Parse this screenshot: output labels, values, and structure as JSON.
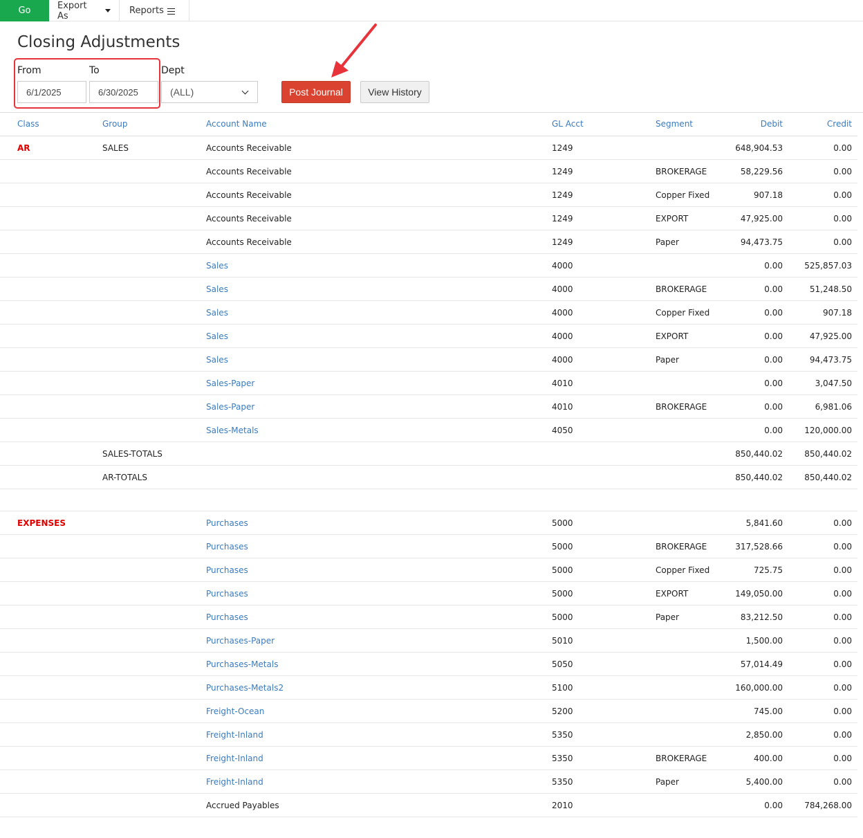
{
  "toolbar": {
    "go_label": "Go",
    "export_label": "Export As",
    "reports_label": "Reports"
  },
  "page_title": "Closing Adjustments",
  "filters": {
    "from_label": "From",
    "to_label": "To",
    "dept_label": "Dept",
    "from_value": "6/1/2025",
    "to_value": "6/30/2025",
    "dept_value": "(ALL)"
  },
  "buttons": {
    "post_journal": "Post Journal",
    "view_history": "View History"
  },
  "colors": {
    "go": "#1aa84f",
    "post": "#d9432f",
    "link": "#3a7bbf",
    "class": "#e00000",
    "annotation": "#e8333a"
  },
  "table": {
    "headers": [
      "Class",
      "Group",
      "Account Name",
      "GL Acct",
      "Segment",
      "Debit",
      "Credit"
    ],
    "rows": [
      {
        "cls": "AR",
        "group": "SALES",
        "name": "Accounts Receivable",
        "link": false,
        "gl": "1249",
        "seg": "",
        "debit": "648,904.53",
        "credit": "0.00"
      },
      {
        "cls": "",
        "group": "",
        "name": "Accounts Receivable",
        "link": false,
        "gl": "1249",
        "seg": "BROKERAGE",
        "debit": "58,229.56",
        "credit": "0.00"
      },
      {
        "cls": "",
        "group": "",
        "name": "Accounts Receivable",
        "link": false,
        "gl": "1249",
        "seg": "Copper Fixed",
        "debit": "907.18",
        "credit": "0.00"
      },
      {
        "cls": "",
        "group": "",
        "name": "Accounts Receivable",
        "link": false,
        "gl": "1249",
        "seg": "EXPORT",
        "debit": "47,925.00",
        "credit": "0.00"
      },
      {
        "cls": "",
        "group": "",
        "name": "Accounts Receivable",
        "link": false,
        "gl": "1249",
        "seg": "Paper",
        "debit": "94,473.75",
        "credit": "0.00"
      },
      {
        "cls": "",
        "group": "",
        "name": "Sales",
        "link": true,
        "gl": "4000",
        "seg": "",
        "debit": "0.00",
        "credit": "525,857.03"
      },
      {
        "cls": "",
        "group": "",
        "name": "Sales",
        "link": true,
        "gl": "4000",
        "seg": "BROKERAGE",
        "debit": "0.00",
        "credit": "51,248.50"
      },
      {
        "cls": "",
        "group": "",
        "name": "Sales",
        "link": true,
        "gl": "4000",
        "seg": "Copper Fixed",
        "debit": "0.00",
        "credit": "907.18"
      },
      {
        "cls": "",
        "group": "",
        "name": "Sales",
        "link": true,
        "gl": "4000",
        "seg": "EXPORT",
        "debit": "0.00",
        "credit": "47,925.00"
      },
      {
        "cls": "",
        "group": "",
        "name": "Sales",
        "link": true,
        "gl": "4000",
        "seg": "Paper",
        "debit": "0.00",
        "credit": "94,473.75"
      },
      {
        "cls": "",
        "group": "",
        "name": "Sales-Paper",
        "link": true,
        "gl": "4010",
        "seg": "",
        "debit": "0.00",
        "credit": "3,047.50"
      },
      {
        "cls": "",
        "group": "",
        "name": "Sales-Paper",
        "link": true,
        "gl": "4010",
        "seg": "BROKERAGE",
        "debit": "0.00",
        "credit": "6,981.06"
      },
      {
        "cls": "",
        "group": "",
        "name": "Sales-Metals",
        "link": true,
        "gl": "4050",
        "seg": "",
        "debit": "0.00",
        "credit": "120,000.00"
      },
      {
        "cls": "",
        "group": "SALES-TOTALS",
        "name": "",
        "link": false,
        "gl": "",
        "seg": "",
        "debit": "850,440.02",
        "credit": "850,440.02"
      },
      {
        "cls": "",
        "group": "AR-TOTALS",
        "name": "",
        "link": false,
        "gl": "",
        "seg": "",
        "debit": "850,440.02",
        "credit": "850,440.02"
      },
      {
        "cls": "",
        "group": "",
        "name": "",
        "link": false,
        "gl": "",
        "seg": "",
        "debit": "",
        "credit": "",
        "spacer": true
      },
      {
        "cls": "EXPENSES",
        "group": "",
        "name": "Purchases",
        "link": true,
        "gl": "5000",
        "seg": "",
        "debit": "5,841.60",
        "credit": "0.00"
      },
      {
        "cls": "",
        "group": "",
        "name": "Purchases",
        "link": true,
        "gl": "5000",
        "seg": "BROKERAGE",
        "debit": "317,528.66",
        "credit": "0.00"
      },
      {
        "cls": "",
        "group": "",
        "name": "Purchases",
        "link": true,
        "gl": "5000",
        "seg": "Copper Fixed",
        "debit": "725.75",
        "credit": "0.00"
      },
      {
        "cls": "",
        "group": "",
        "name": "Purchases",
        "link": true,
        "gl": "5000",
        "seg": "EXPORT",
        "debit": "149,050.00",
        "credit": "0.00"
      },
      {
        "cls": "",
        "group": "",
        "name": "Purchases",
        "link": true,
        "gl": "5000",
        "seg": "Paper",
        "debit": "83,212.50",
        "credit": "0.00"
      },
      {
        "cls": "",
        "group": "",
        "name": "Purchases-Paper",
        "link": true,
        "gl": "5010",
        "seg": "",
        "debit": "1,500.00",
        "credit": "0.00"
      },
      {
        "cls": "",
        "group": "",
        "name": "Purchases-Metals",
        "link": true,
        "gl": "5050",
        "seg": "",
        "debit": "57,014.49",
        "credit": "0.00"
      },
      {
        "cls": "",
        "group": "",
        "name": "Purchases-Metals2",
        "link": true,
        "gl": "5100",
        "seg": "",
        "debit": "160,000.00",
        "credit": "0.00"
      },
      {
        "cls": "",
        "group": "",
        "name": "Freight-Ocean",
        "link": true,
        "gl": "5200",
        "seg": "",
        "debit": "745.00",
        "credit": "0.00"
      },
      {
        "cls": "",
        "group": "",
        "name": "Freight-Inland",
        "link": true,
        "gl": "5350",
        "seg": "",
        "debit": "2,850.00",
        "credit": "0.00"
      },
      {
        "cls": "",
        "group": "",
        "name": "Freight-Inland",
        "link": true,
        "gl": "5350",
        "seg": "BROKERAGE",
        "debit": "400.00",
        "credit": "0.00"
      },
      {
        "cls": "",
        "group": "",
        "name": "Freight-Inland",
        "link": true,
        "gl": "5350",
        "seg": "Paper",
        "debit": "5,400.00",
        "credit": "0.00"
      },
      {
        "cls": "",
        "group": "",
        "name": "Accrued Payables",
        "link": false,
        "gl": "2010",
        "seg": "",
        "debit": "0.00",
        "credit": "784,268.00"
      }
    ]
  }
}
